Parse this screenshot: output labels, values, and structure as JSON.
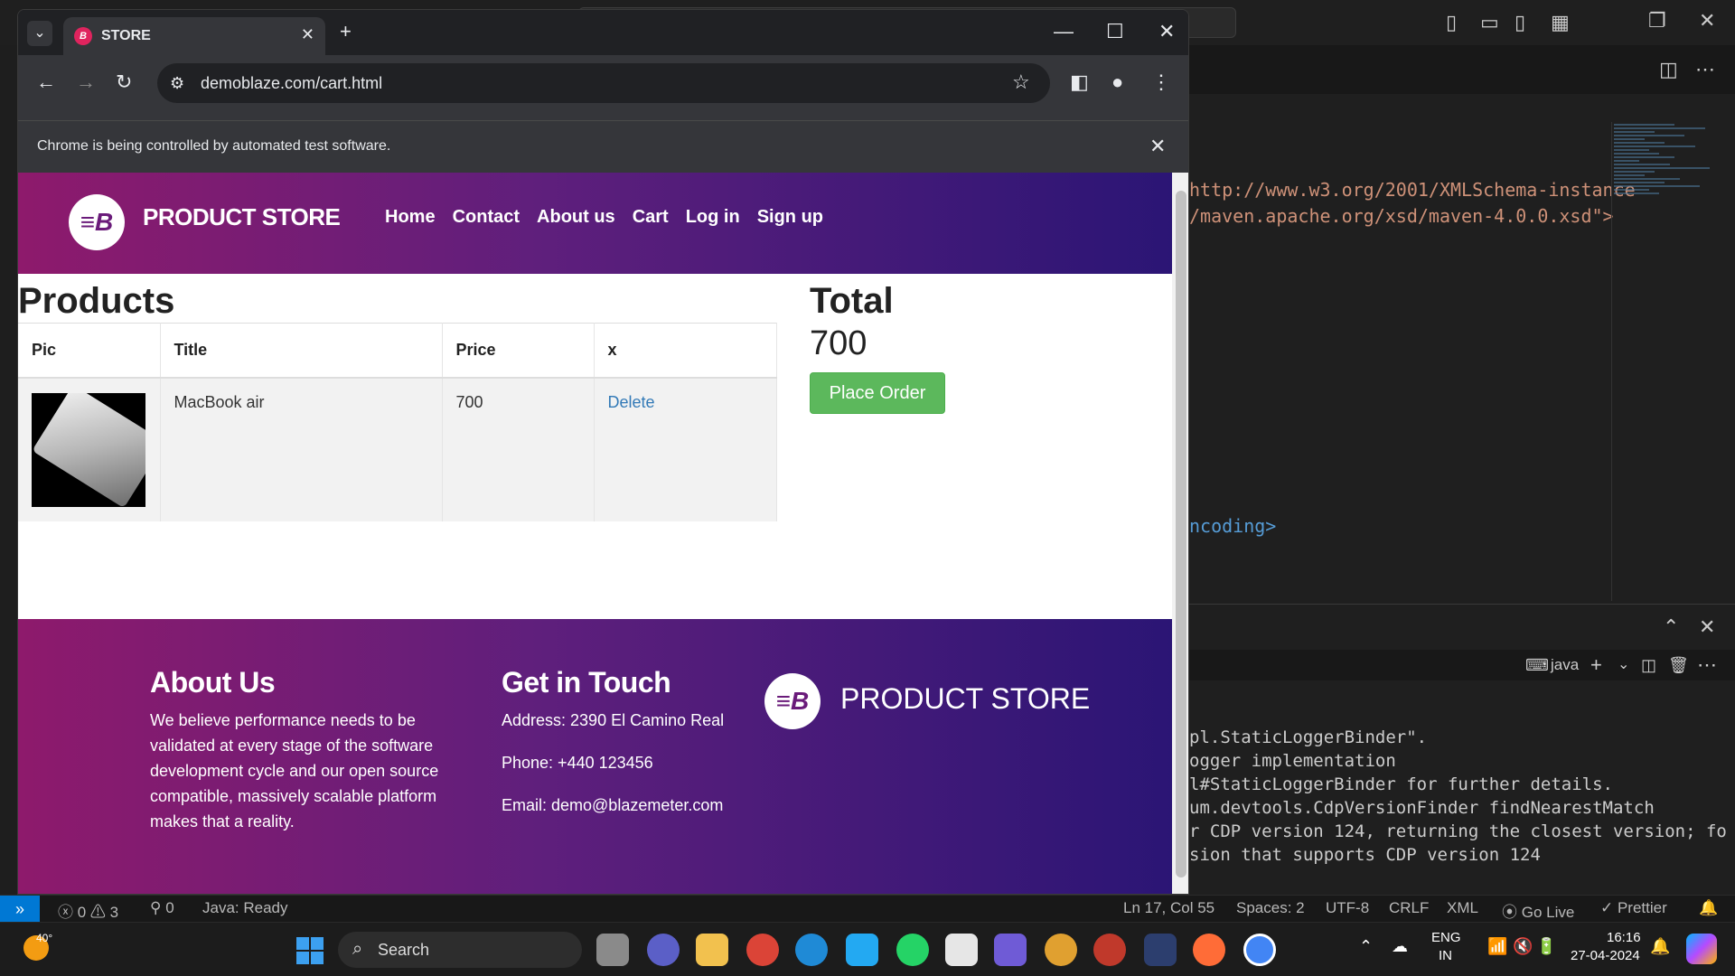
{
  "browser": {
    "tab_title": "STORE",
    "url": "demoblaze.com/cart.html",
    "infobar_text": "Chrome is being controlled by automated test software."
  },
  "site": {
    "brand": "PRODUCT STORE",
    "nav": [
      "Home",
      "Contact",
      "About us",
      "Cart",
      "Log in",
      "Sign up"
    ]
  },
  "cart": {
    "products_heading": "Products",
    "columns": [
      "Pic",
      "Title",
      "Price",
      "x"
    ],
    "rows": [
      {
        "title": "MacBook air",
        "price": "700",
        "action": "Delete"
      }
    ],
    "total_heading": "Total",
    "total_value": "700",
    "place_order_label": "Place Order"
  },
  "footer": {
    "about_title": "About Us",
    "about_text": "We believe performance needs to be validated at every stage of the software development cycle and our open source compatible, massively scalable platform makes that a reality.",
    "contact_title": "Get in Touch",
    "address": "Address: 2390 El Camino Real",
    "phone": "Phone: +440 123456",
    "email": "Email: demo@blazemeter.com",
    "brand": "PRODUCT STORE"
  },
  "vscode": {
    "editor_lines": [
      "http://www.w3.org/2001/XMLSchema-instance",
      "/maven.apache.org/xsd/maven-4.0.0.xsd\">",
      "ncoding>"
    ],
    "terminal_profile": "java",
    "terminal_lines": [
      "pl.StaticLoggerBinder\".",
      "ogger implementation",
      "l#StaticLoggerBinder for further details.",
      "um.devtools.CdpVersionFinder findNearestMatch",
      "r CDP version 124, returning the closest version; fo",
      "sion that supports CDP version 124"
    ],
    "status": {
      "errors": "0",
      "warnings": "3",
      "ports": "0",
      "java": "Java: Ready",
      "position": "Ln 17, Col 55",
      "spaces": "Spaces: 2",
      "encoding": "UTF-8",
      "eol": "CRLF",
      "language": "XML",
      "golive": "Go Live",
      "prettier": "Prettier"
    }
  },
  "taskbar": {
    "weather": "40°",
    "search_placeholder": "Search",
    "language_top": "ENG",
    "language_bottom": "IN",
    "time": "16:16",
    "date": "27-04-2024"
  },
  "colors": {
    "accent_gradient_start": "#8e1a6c",
    "accent_gradient_end": "#2b1575",
    "place_order_green": "#5cb85c",
    "link_blue": "#337ab7"
  }
}
